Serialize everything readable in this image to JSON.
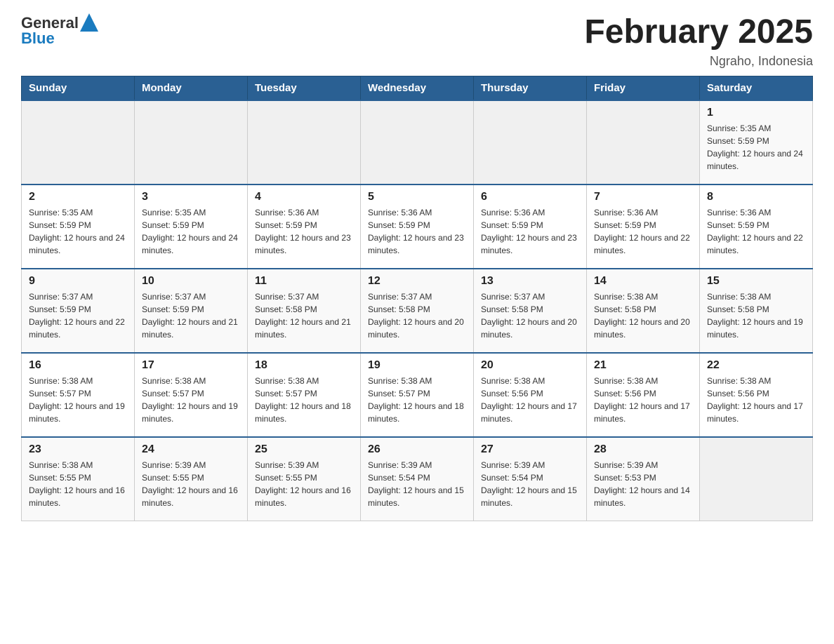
{
  "header": {
    "logo_general": "General",
    "logo_blue": "Blue",
    "month_title": "February 2025",
    "location": "Ngraho, Indonesia"
  },
  "days_of_week": [
    "Sunday",
    "Monday",
    "Tuesday",
    "Wednesday",
    "Thursday",
    "Friday",
    "Saturday"
  ],
  "weeks": [
    {
      "days": [
        {
          "num": "",
          "sunrise": "",
          "sunset": "",
          "daylight": "",
          "empty": true
        },
        {
          "num": "",
          "sunrise": "",
          "sunset": "",
          "daylight": "",
          "empty": true
        },
        {
          "num": "",
          "sunrise": "",
          "sunset": "",
          "daylight": "",
          "empty": true
        },
        {
          "num": "",
          "sunrise": "",
          "sunset": "",
          "daylight": "",
          "empty": true
        },
        {
          "num": "",
          "sunrise": "",
          "sunset": "",
          "daylight": "",
          "empty": true
        },
        {
          "num": "",
          "sunrise": "",
          "sunset": "",
          "daylight": "",
          "empty": true
        },
        {
          "num": "1",
          "sunrise": "Sunrise: 5:35 AM",
          "sunset": "Sunset: 5:59 PM",
          "daylight": "Daylight: 12 hours and 24 minutes.",
          "empty": false
        }
      ]
    },
    {
      "days": [
        {
          "num": "2",
          "sunrise": "Sunrise: 5:35 AM",
          "sunset": "Sunset: 5:59 PM",
          "daylight": "Daylight: 12 hours and 24 minutes.",
          "empty": false
        },
        {
          "num": "3",
          "sunrise": "Sunrise: 5:35 AM",
          "sunset": "Sunset: 5:59 PM",
          "daylight": "Daylight: 12 hours and 24 minutes.",
          "empty": false
        },
        {
          "num": "4",
          "sunrise": "Sunrise: 5:36 AM",
          "sunset": "Sunset: 5:59 PM",
          "daylight": "Daylight: 12 hours and 23 minutes.",
          "empty": false
        },
        {
          "num": "5",
          "sunrise": "Sunrise: 5:36 AM",
          "sunset": "Sunset: 5:59 PM",
          "daylight": "Daylight: 12 hours and 23 minutes.",
          "empty": false
        },
        {
          "num": "6",
          "sunrise": "Sunrise: 5:36 AM",
          "sunset": "Sunset: 5:59 PM",
          "daylight": "Daylight: 12 hours and 23 minutes.",
          "empty": false
        },
        {
          "num": "7",
          "sunrise": "Sunrise: 5:36 AM",
          "sunset": "Sunset: 5:59 PM",
          "daylight": "Daylight: 12 hours and 22 minutes.",
          "empty": false
        },
        {
          "num": "8",
          "sunrise": "Sunrise: 5:36 AM",
          "sunset": "Sunset: 5:59 PM",
          "daylight": "Daylight: 12 hours and 22 minutes.",
          "empty": false
        }
      ]
    },
    {
      "days": [
        {
          "num": "9",
          "sunrise": "Sunrise: 5:37 AM",
          "sunset": "Sunset: 5:59 PM",
          "daylight": "Daylight: 12 hours and 22 minutes.",
          "empty": false
        },
        {
          "num": "10",
          "sunrise": "Sunrise: 5:37 AM",
          "sunset": "Sunset: 5:59 PM",
          "daylight": "Daylight: 12 hours and 21 minutes.",
          "empty": false
        },
        {
          "num": "11",
          "sunrise": "Sunrise: 5:37 AM",
          "sunset": "Sunset: 5:58 PM",
          "daylight": "Daylight: 12 hours and 21 minutes.",
          "empty": false
        },
        {
          "num": "12",
          "sunrise": "Sunrise: 5:37 AM",
          "sunset": "Sunset: 5:58 PM",
          "daylight": "Daylight: 12 hours and 20 minutes.",
          "empty": false
        },
        {
          "num": "13",
          "sunrise": "Sunrise: 5:37 AM",
          "sunset": "Sunset: 5:58 PM",
          "daylight": "Daylight: 12 hours and 20 minutes.",
          "empty": false
        },
        {
          "num": "14",
          "sunrise": "Sunrise: 5:38 AM",
          "sunset": "Sunset: 5:58 PM",
          "daylight": "Daylight: 12 hours and 20 minutes.",
          "empty": false
        },
        {
          "num": "15",
          "sunrise": "Sunrise: 5:38 AM",
          "sunset": "Sunset: 5:58 PM",
          "daylight": "Daylight: 12 hours and 19 minutes.",
          "empty": false
        }
      ]
    },
    {
      "days": [
        {
          "num": "16",
          "sunrise": "Sunrise: 5:38 AM",
          "sunset": "Sunset: 5:57 PM",
          "daylight": "Daylight: 12 hours and 19 minutes.",
          "empty": false
        },
        {
          "num": "17",
          "sunrise": "Sunrise: 5:38 AM",
          "sunset": "Sunset: 5:57 PM",
          "daylight": "Daylight: 12 hours and 19 minutes.",
          "empty": false
        },
        {
          "num": "18",
          "sunrise": "Sunrise: 5:38 AM",
          "sunset": "Sunset: 5:57 PM",
          "daylight": "Daylight: 12 hours and 18 minutes.",
          "empty": false
        },
        {
          "num": "19",
          "sunrise": "Sunrise: 5:38 AM",
          "sunset": "Sunset: 5:57 PM",
          "daylight": "Daylight: 12 hours and 18 minutes.",
          "empty": false
        },
        {
          "num": "20",
          "sunrise": "Sunrise: 5:38 AM",
          "sunset": "Sunset: 5:56 PM",
          "daylight": "Daylight: 12 hours and 17 minutes.",
          "empty": false
        },
        {
          "num": "21",
          "sunrise": "Sunrise: 5:38 AM",
          "sunset": "Sunset: 5:56 PM",
          "daylight": "Daylight: 12 hours and 17 minutes.",
          "empty": false
        },
        {
          "num": "22",
          "sunrise": "Sunrise: 5:38 AM",
          "sunset": "Sunset: 5:56 PM",
          "daylight": "Daylight: 12 hours and 17 minutes.",
          "empty": false
        }
      ]
    },
    {
      "days": [
        {
          "num": "23",
          "sunrise": "Sunrise: 5:38 AM",
          "sunset": "Sunset: 5:55 PM",
          "daylight": "Daylight: 12 hours and 16 minutes.",
          "empty": false
        },
        {
          "num": "24",
          "sunrise": "Sunrise: 5:39 AM",
          "sunset": "Sunset: 5:55 PM",
          "daylight": "Daylight: 12 hours and 16 minutes.",
          "empty": false
        },
        {
          "num": "25",
          "sunrise": "Sunrise: 5:39 AM",
          "sunset": "Sunset: 5:55 PM",
          "daylight": "Daylight: 12 hours and 16 minutes.",
          "empty": false
        },
        {
          "num": "26",
          "sunrise": "Sunrise: 5:39 AM",
          "sunset": "Sunset: 5:54 PM",
          "daylight": "Daylight: 12 hours and 15 minutes.",
          "empty": false
        },
        {
          "num": "27",
          "sunrise": "Sunrise: 5:39 AM",
          "sunset": "Sunset: 5:54 PM",
          "daylight": "Daylight: 12 hours and 15 minutes.",
          "empty": false
        },
        {
          "num": "28",
          "sunrise": "Sunrise: 5:39 AM",
          "sunset": "Sunset: 5:53 PM",
          "daylight": "Daylight: 12 hours and 14 minutes.",
          "empty": false
        },
        {
          "num": "",
          "sunrise": "",
          "sunset": "",
          "daylight": "",
          "empty": true
        }
      ]
    }
  ]
}
